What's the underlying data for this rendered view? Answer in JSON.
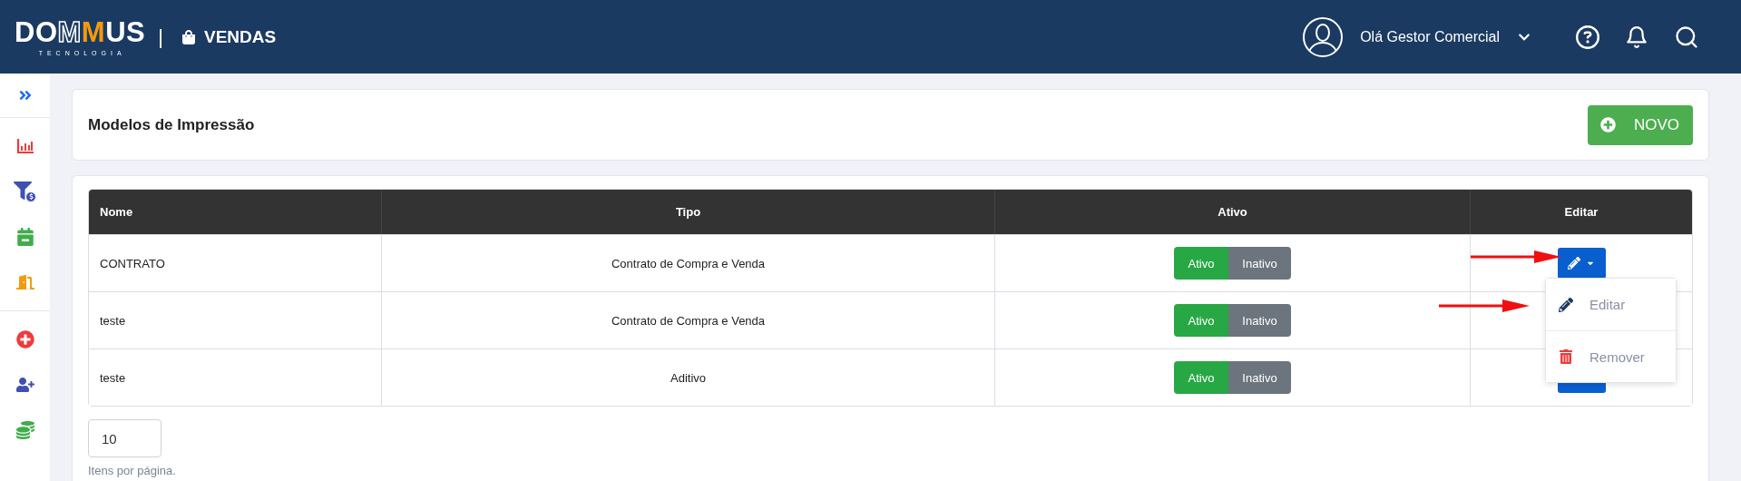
{
  "header": {
    "logo": {
      "parts": [
        {
          "text": "DO",
          "kind": "plain"
        },
        {
          "text": "M",
          "kind": "outline"
        },
        {
          "text": "M",
          "kind": "highlight"
        },
        {
          "text": "US",
          "kind": "plain"
        }
      ],
      "tagline": "TECNOLOGIA"
    },
    "separator": "|",
    "module": "VENDAS",
    "user_greeting": "Olá Gestor Comercial"
  },
  "page": {
    "title": "Modelos de Impressão",
    "new_button": "NOVO"
  },
  "table": {
    "columns": [
      "Nome",
      "Tipo",
      "Ativo",
      "Editar"
    ],
    "rows": [
      {
        "nome": "CONTRATO",
        "tipo": "Contrato de Compra e Venda",
        "status": [
          {
            "label": "Ativo",
            "selected": true
          },
          {
            "label": "Inativo",
            "selected": false
          }
        ]
      },
      {
        "nome": "teste",
        "tipo": "Contrato de Compra e Venda",
        "status": [
          {
            "label": "Ativo",
            "selected": true
          },
          {
            "label": "Inativo",
            "selected": false
          }
        ]
      },
      {
        "nome": "teste",
        "tipo": "Aditivo",
        "status": [
          {
            "label": "Ativo",
            "selected": true
          },
          {
            "label": "Inativo",
            "selected": false
          }
        ]
      }
    ]
  },
  "edit_menu": {
    "items": [
      {
        "label": "Editar",
        "kind": "edit"
      },
      {
        "label": "Remover",
        "kind": "remove"
      }
    ]
  },
  "pagination": {
    "page_size": "10",
    "hint": "Itens por página."
  }
}
